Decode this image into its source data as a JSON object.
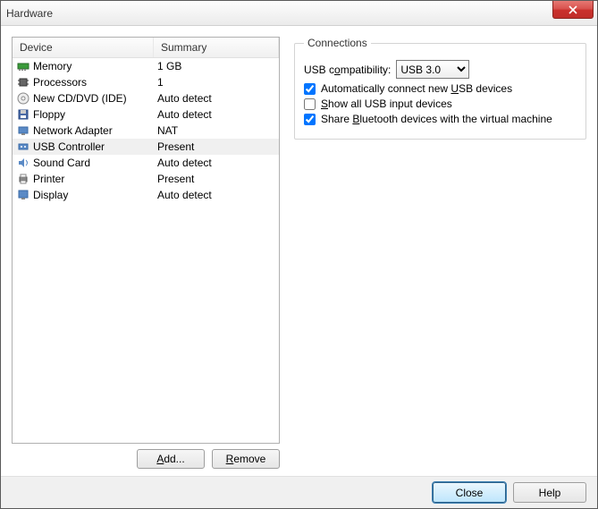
{
  "window": {
    "title": "Hardware"
  },
  "columns": {
    "device": "Device",
    "summary": "Summary"
  },
  "devices": [
    {
      "name": "Memory",
      "summary": "1 GB",
      "icon": "memory",
      "selected": false
    },
    {
      "name": "Processors",
      "summary": "1",
      "icon": "cpu",
      "selected": false
    },
    {
      "name": "New CD/DVD (IDE)",
      "summary": "Auto detect",
      "icon": "disc",
      "selected": false
    },
    {
      "name": "Floppy",
      "summary": "Auto detect",
      "icon": "floppy",
      "selected": false
    },
    {
      "name": "Network Adapter",
      "summary": "NAT",
      "icon": "network",
      "selected": false
    },
    {
      "name": "USB Controller",
      "summary": "Present",
      "icon": "usb",
      "selected": true
    },
    {
      "name": "Sound Card",
      "summary": "Auto detect",
      "icon": "sound",
      "selected": false
    },
    {
      "name": "Printer",
      "summary": "Present",
      "icon": "printer",
      "selected": false
    },
    {
      "name": "Display",
      "summary": "Auto detect",
      "icon": "display",
      "selected": false
    }
  ],
  "buttons": {
    "add": "Add...",
    "remove": "Remove",
    "close": "Close",
    "help": "Help"
  },
  "connections": {
    "legend": "Connections",
    "usb_compat_label": "USB compatibility:",
    "usb_compat_value": "USB 3.0",
    "auto_connect": {
      "label": "Automatically connect new USB devices",
      "checked": true
    },
    "show_all": {
      "label": "Show all USB input devices",
      "checked": false
    },
    "share_bt": {
      "label": "Share Bluetooth devices with the virtual machine",
      "checked": true
    }
  }
}
